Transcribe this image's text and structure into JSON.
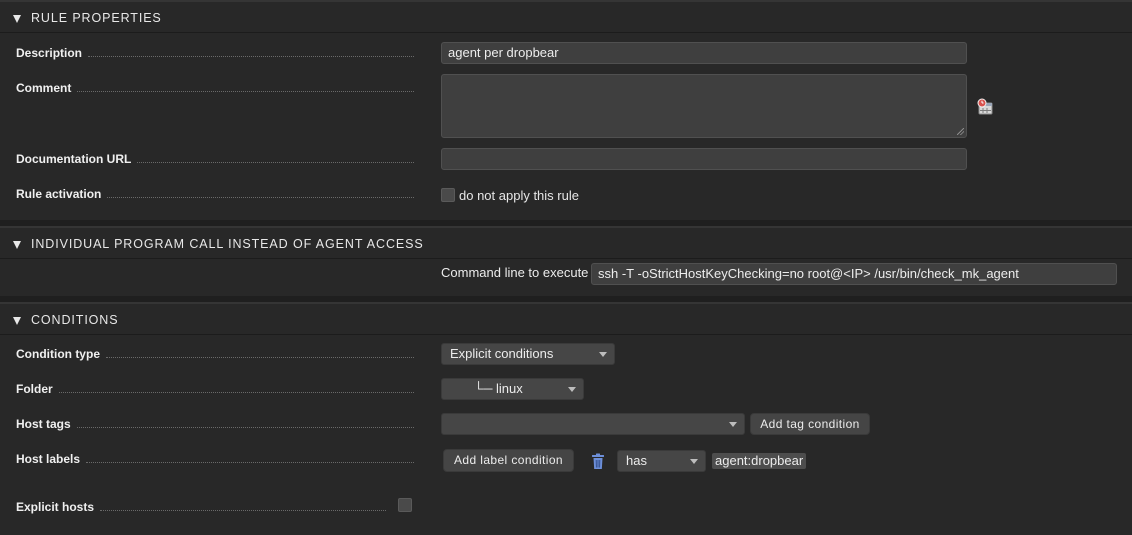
{
  "sections": {
    "rule_properties": {
      "title": "RULE PROPERTIES",
      "description": {
        "label": "Description",
        "value": "agent per dropbear"
      },
      "comment": {
        "label": "Comment",
        "value": ""
      },
      "documentation_url": {
        "label": "Documentation URL",
        "value": ""
      },
      "rule_activation": {
        "label": "Rule activation",
        "checkbox_label": "do not apply this rule"
      }
    },
    "program_call": {
      "title": "INDIVIDUAL PROGRAM CALL INSTEAD OF AGENT ACCESS",
      "command_label": "Command line to execute",
      "command_value": "ssh -T -oStrictHostKeyChecking=no root@<IP> /usr/bin/check_mk_agent"
    },
    "conditions": {
      "title": "CONDITIONS",
      "condition_type": {
        "label": "Condition type",
        "value": "Explicit conditions"
      },
      "folder": {
        "label": "Folder",
        "value": "└─ linux"
      },
      "host_tags": {
        "label": "Host tags",
        "value": "",
        "button": "Add tag condition"
      },
      "host_labels": {
        "label": "Host labels",
        "button": "Add label condition",
        "operator": "has",
        "label_value": "agent:dropbear"
      },
      "explicit_hosts": {
        "label": "Explicit hosts"
      }
    }
  },
  "icons": {
    "comment_timestamp": "calendar-clock-icon",
    "delete_label": "trash-icon"
  },
  "colors": {
    "background": "#1f1f1f",
    "section": "#282828",
    "input": "#3f3f3f",
    "trash": "#6d8fd9",
    "clock_red": "#d9534f"
  }
}
